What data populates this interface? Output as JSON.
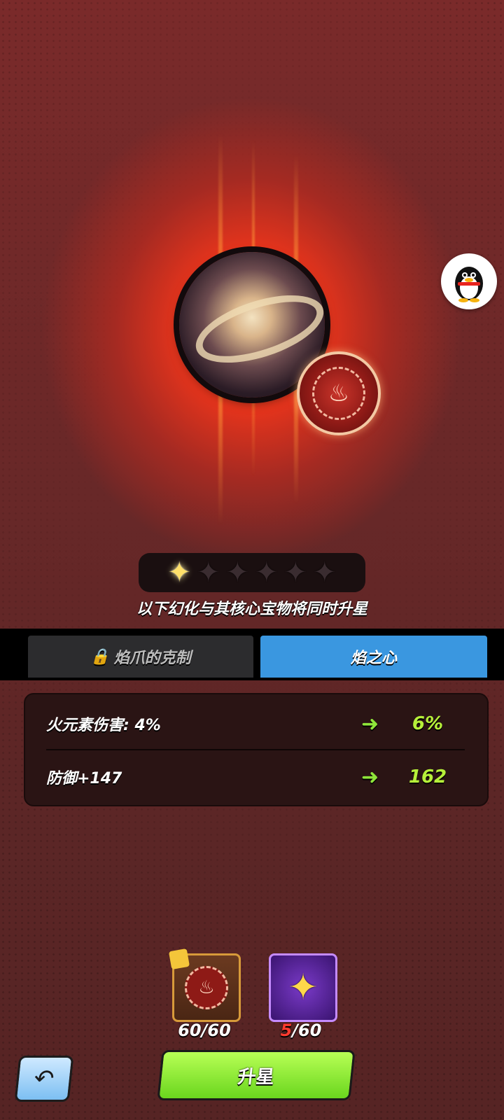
{
  "stars": {
    "filled": 1,
    "total": 6
  },
  "notice": "以下幻化与其核心宝物将同时升星",
  "tabs": [
    {
      "label": "焰爪的克制",
      "locked": true,
      "active": false
    },
    {
      "label": "焰之心",
      "locked": false,
      "active": true
    }
  ],
  "stats": [
    {
      "label": "火元素伤害: 4%",
      "new_value": "6%"
    },
    {
      "label": "防御+147",
      "new_value": "162"
    }
  ],
  "materials": [
    {
      "icon": "fire-coin-icon",
      "count": "60/60"
    },
    {
      "icon": "gold-star-icon",
      "have": "5",
      "need": "/60"
    }
  ],
  "buttons": {
    "upgrade": "升星",
    "back_icon": "back-arrow-icon"
  },
  "colors": {
    "active_tab": "#3a97e0",
    "upgrade": "#7ee02a",
    "stat_value": "#b6f03a",
    "shortage": "#ff3b2f"
  }
}
